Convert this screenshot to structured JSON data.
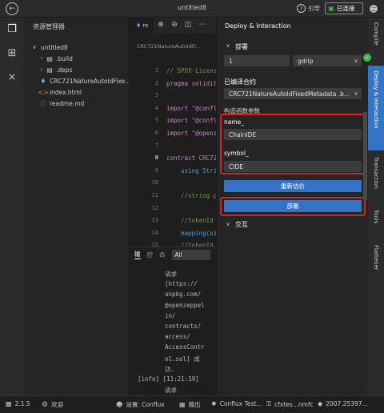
{
  "title": "untitled8",
  "titlebar": {
    "guide_label": "引导",
    "connected_label": "已连接"
  },
  "explorer": {
    "header": "资源管理器",
    "items": [
      {
        "label": "untitled8"
      },
      {
        "label": ".build"
      },
      {
        "label": ".deps"
      },
      {
        "label": "CRC721NatureAutoIdFixe..."
      },
      {
        "label": "index.html"
      },
      {
        "label": "readme.md"
      }
    ]
  },
  "editor": {
    "tab_label": "re",
    "breadcrumb": "CRC721NatureAutoIdFi...",
    "lines": [
      {
        "n": "1",
        "text": "// SPDX-Licens"
      },
      {
        "n": "2",
        "text": "pragma solidit"
      },
      {
        "n": "3",
        "text": ""
      },
      {
        "n": "4",
        "text": "import \"@confl"
      },
      {
        "n": "5",
        "text": "import \"@confl"
      },
      {
        "n": "6",
        "text": "import \"@openz"
      },
      {
        "n": "7",
        "text": ""
      },
      {
        "n": "8",
        "text": "contract CRC72"
      },
      {
        "n": "9",
        "text": "    using Stri"
      },
      {
        "n": "10",
        "text": ""
      },
      {
        "n": "11",
        "text": "    //string p"
      },
      {
        "n": "12",
        "text": ""
      },
      {
        "n": "13",
        "text": "    //tokenId"
      },
      {
        "n": "14",
        "text": "    mapping(ui"
      },
      {
        "n": "15",
        "text": "    //tokenId"
      },
      {
        "n": "16",
        "text": "    mapping(ui"
      },
      {
        "n": "17",
        "text": ""
      },
      {
        "n": "18",
        "text": "    // Counter"
      }
    ]
  },
  "panel": {
    "tabs": [
      "输",
      "控",
      "命"
    ],
    "filter": "All",
    "output_lines": [
      "请求",
      "[https://",
      "unpkg.com/",
      "@openzeppel",
      "in/",
      "contracts/",
      "access/",
      "AccessContr",
      "ol.sol] 成",
      "功.",
      "[info] [11:21:19]",
      "请求"
    ]
  },
  "deploy": {
    "header": "Deploy & Interaction",
    "section_deploy": "部署",
    "amount_value": "1",
    "unit_value": "gdrip",
    "compiled_label": "已编译合约",
    "contract_value": "CRC721NatureAutoIdFixedMetadata .b...",
    "ctor_label": "构造函数参数",
    "param1_label": "name_",
    "param1_value": "ChainIDE",
    "param2_label": "symbol_",
    "param2_value": "CIDE",
    "estimate_button": "重新估价",
    "deploy_button": "部署",
    "section_interact": "交互"
  },
  "rightbar": {
    "tabs": [
      "Compile",
      "Deploy & Interaction",
      "Transaction",
      "Tools",
      "Flattener"
    ]
  },
  "status": {
    "version": "2.1.5",
    "welcome": "欢迎",
    "settings": "设置: Conflux",
    "output": "输出",
    "network": "Conflux Test...",
    "account": "cfxtes...nmfc",
    "build": "2007.25397..."
  },
  "colors": {
    "accent": "#3574c4",
    "highlight": "#e01e1e",
    "success": "#3fb950"
  }
}
